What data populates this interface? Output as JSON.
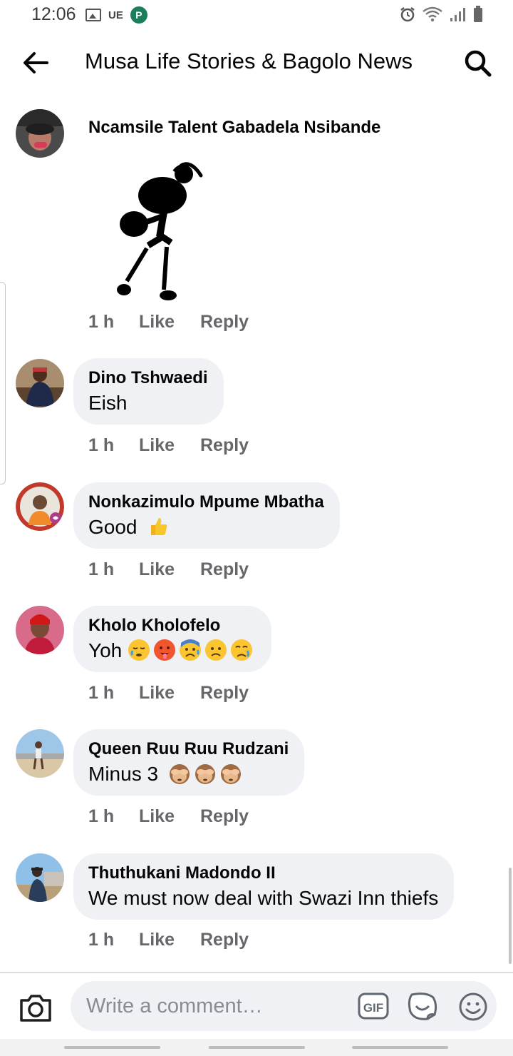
{
  "status_bar": {
    "time": "12:06",
    "carrier": "UE",
    "badge": "P"
  },
  "header": {
    "title": "Musa Life Stories & Bagolo News"
  },
  "comments": [
    {
      "name": "Ncamsile Talent Gabadela Nsibande",
      "text": "",
      "time": "1 h",
      "like": "Like",
      "reply": "Reply",
      "sticker": "black-figure-sticker"
    },
    {
      "name": "Dino Tshwaedi",
      "text": "Eish",
      "time": "1 h",
      "like": "Like",
      "reply": "Reply"
    },
    {
      "name": "Nonkazimulo Mpume Mbatha",
      "text": "Good",
      "time": "1 h",
      "like": "Like",
      "reply": "Reply",
      "emoji": [
        "thumbs-up"
      ]
    },
    {
      "name": "Kholo Kholofelo",
      "text": "Yoh",
      "time": "1 h",
      "like": "Like",
      "reply": "Reply",
      "emoji": [
        "sleepy-face",
        "hot-face",
        "anxious-face",
        "worried-face",
        "sad-face"
      ]
    },
    {
      "name": "Queen Ruu Ruu Rudzani",
      "text": "Minus 3",
      "time": "1 h",
      "like": "Like",
      "reply": "Reply",
      "emoji": [
        "see-no-evil-monkey",
        "see-no-evil-monkey",
        "see-no-evil-monkey"
      ]
    },
    {
      "name": "Thuthukani Madondo II",
      "text": "We must now deal with Swazi Inn thiefs",
      "time": "1 h",
      "like": "Like",
      "reply": "Reply"
    }
  ],
  "composer": {
    "placeholder": "Write a comment…",
    "gif_label": "GIF"
  },
  "colors": {
    "bubble": "#eff1f4",
    "action_text": "#65676b",
    "text": "#050505"
  }
}
